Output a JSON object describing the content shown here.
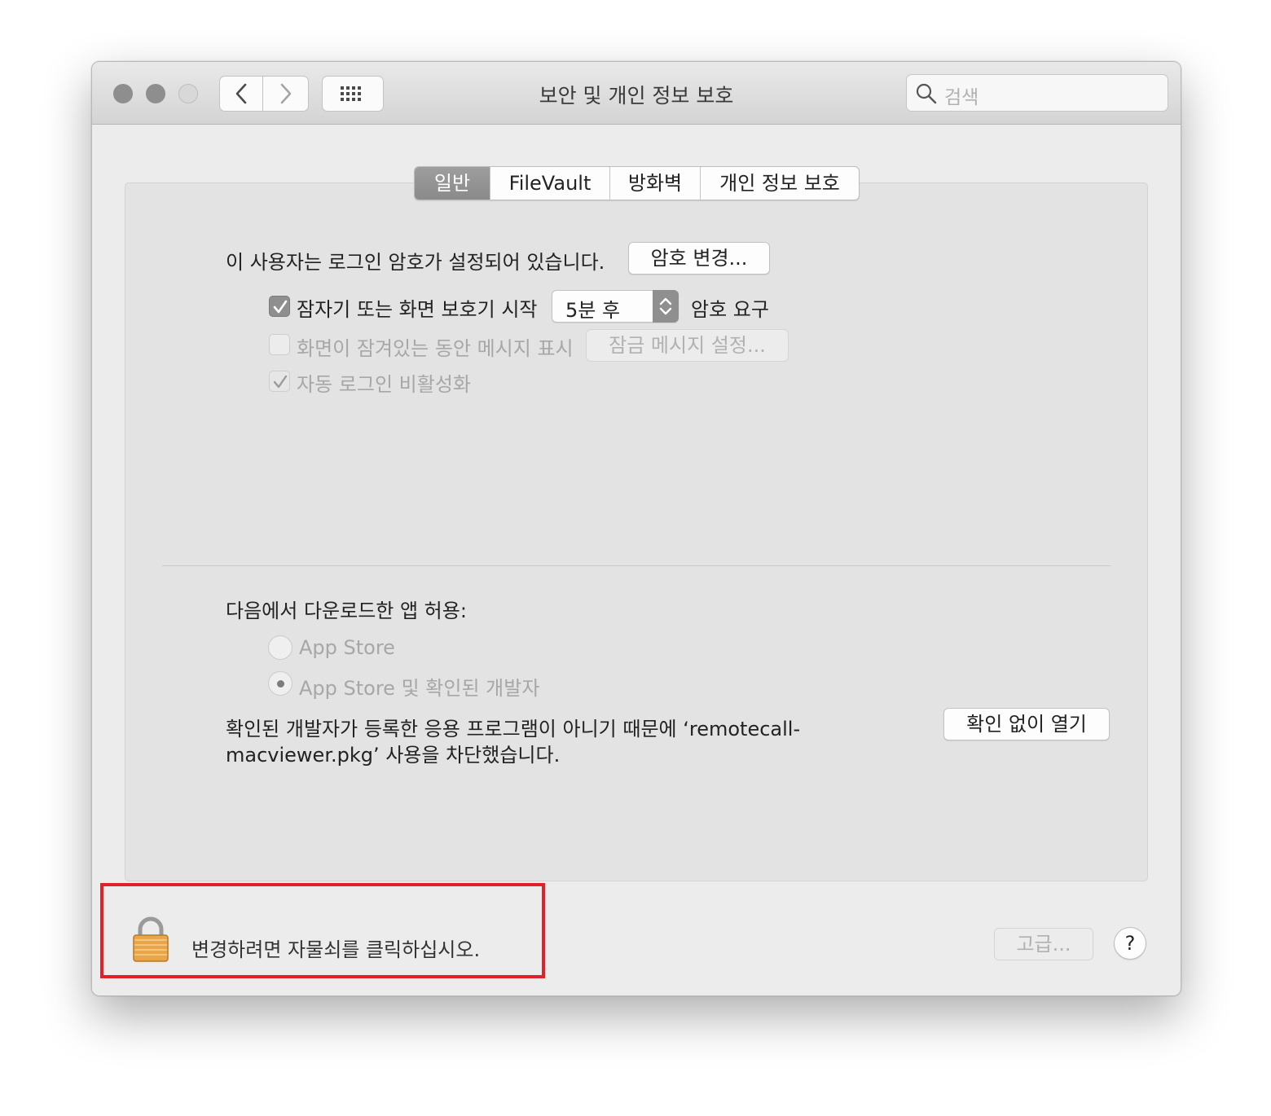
{
  "window": {
    "title": "보안 및 개인 정보 보호",
    "search_placeholder": "검색"
  },
  "tabs": [
    {
      "label": "일반",
      "active": true
    },
    {
      "label": "FileVault",
      "active": false
    },
    {
      "label": "방화벽",
      "active": false
    },
    {
      "label": "개인 정보 보호",
      "active": false
    }
  ],
  "general": {
    "password_text": "이 사용자는 로그인 암호가 설정되어 있습니다.",
    "change_password_button": "암호 변경...",
    "require_password": {
      "label": "잠자기 또는 화면 보호기 시작",
      "checked": true,
      "delay_value": "5분 후",
      "suffix": "암호 요구"
    },
    "show_message": {
      "label": "화면이 잠겨있는 동안 메시지 표시",
      "checked": false,
      "button": "잠금 메시지 설정..."
    },
    "disable_autologin": {
      "label": "자동 로그인 비활성화",
      "checked": true
    }
  },
  "downloads": {
    "heading": "다음에서 다운로드한 앱 허용:",
    "options": [
      {
        "label": "App Store",
        "selected": false
      },
      {
        "label": "App Store 및 확인된 개발자",
        "selected": true
      }
    ],
    "blocked_line1": "확인된 개발자가 등록한 응용 프로그램이 아니기 때문에 ‘remotecall-",
    "blocked_line2": "macviewer.pkg’ 사용을 차단했습니다.",
    "open_anyway_button": "확인 없이 열기"
  },
  "footer": {
    "lock_text": "변경하려면 자물쇠를 클릭하십시오.",
    "advanced_button": "고급...",
    "help_button": "?"
  },
  "colors": {
    "highlight": "#e3202a",
    "lock_gold": "#e8a54a"
  }
}
